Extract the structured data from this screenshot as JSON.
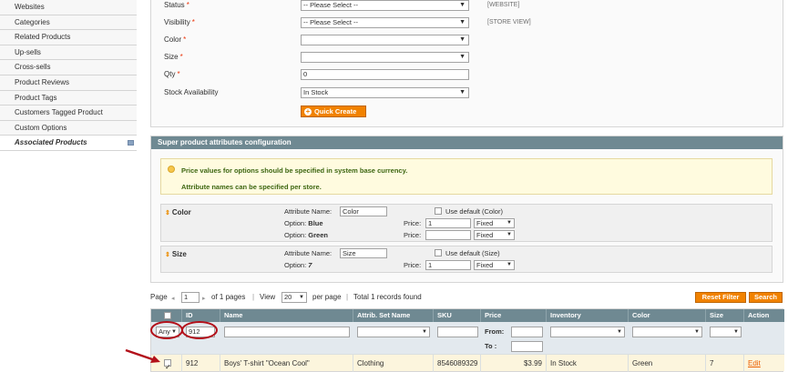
{
  "sidebar": {
    "items": [
      {
        "label": "Websites"
      },
      {
        "label": "Categories"
      },
      {
        "label": "Related Products"
      },
      {
        "label": "Up-sells"
      },
      {
        "label": "Cross-sells"
      },
      {
        "label": "Product Reviews"
      },
      {
        "label": "Product Tags"
      },
      {
        "label": "Customers Tagged Product"
      },
      {
        "label": "Custom Options"
      },
      {
        "label": "Associated Products"
      }
    ]
  },
  "quick_create": {
    "status": {
      "label": "Status",
      "value": "-- Please Select --",
      "scope": "[WEBSITE]"
    },
    "visibility": {
      "label": "Visibility",
      "value": "-- Please Select --",
      "scope": "[STORE VIEW]"
    },
    "color": {
      "label": "Color",
      "value": ""
    },
    "size": {
      "label": "Size",
      "value": ""
    },
    "qty": {
      "label": "Qty",
      "value": "0"
    },
    "stock": {
      "label": "Stock Availability",
      "value": "In Stock"
    },
    "required_mark": "*",
    "button_label": "Quick Create"
  },
  "super_config": {
    "title": "Super product attributes configuration",
    "notice_1": "Price values for options should be specified in system base currency.",
    "notice_2": "Attribute names can be specified per store.",
    "attr_name_label": "Attribute Name:",
    "price_label": "Price:",
    "attributes": [
      {
        "title": "Color",
        "name_value": "Color",
        "use_default": "Use default (Color)",
        "options": [
          {
            "prefix": "Option:",
            "name": "Blue",
            "price": "1",
            "type": "Fixed"
          },
          {
            "prefix": "Option:",
            "name": "Green",
            "price": "",
            "type": "Fixed"
          }
        ]
      },
      {
        "title": "Size",
        "name_value": "Size",
        "use_default": "Use default (Size)",
        "options": [
          {
            "prefix": "Option:",
            "name": "7",
            "price": "1",
            "type": "Fixed"
          }
        ]
      }
    ]
  },
  "pager": {
    "page_label": "Page",
    "page_value": "1",
    "of_pages": "of 1 pages",
    "view_label": "View",
    "view_value": "20",
    "per_page": "per page",
    "total": "Total 1 records found",
    "reset_label": "Reset Filter",
    "search_label": "Search"
  },
  "grid": {
    "headers": [
      "",
      "ID",
      "Name",
      "Attrib. Set Name",
      "SKU",
      "Price",
      "Inventory",
      "Color",
      "Size",
      "Action"
    ],
    "filter": {
      "any": "Any",
      "id": "912",
      "from": "From:",
      "to": "To :"
    },
    "rows": [
      {
        "id": "912",
        "name": "Boys' T-shirt \"Ocean Cool\"",
        "set": "Clothing",
        "sku": "8546089329",
        "price": "$3.99",
        "inventory": "In Stock",
        "color": "Green",
        "size": "7",
        "action": "Edit"
      }
    ]
  },
  "colors": {
    "accent": "#f18200",
    "header": "#6f8992",
    "annotation": "#b3101a"
  }
}
